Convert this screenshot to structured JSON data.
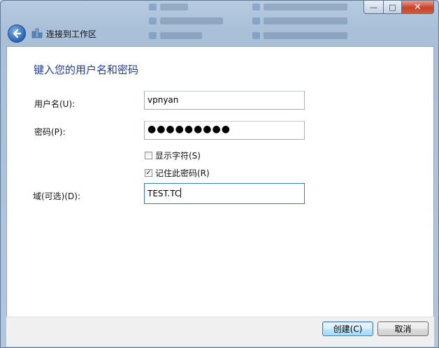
{
  "window": {
    "title": "连接到工作区",
    "caption": {
      "minimize": "—",
      "maximize": "□",
      "close": "✕"
    }
  },
  "form": {
    "heading": "键入您的用户名和密码",
    "username": {
      "label": "用户名(U):",
      "value": "vpnyan"
    },
    "password": {
      "label": "密码(P):",
      "value": "●●●●●●●●●"
    },
    "show_chars": {
      "label": "显示字符(S)",
      "checked": false
    },
    "remember": {
      "label": "记住此密码(R)",
      "checked": true,
      "mark": "✓"
    },
    "domain": {
      "label": "域(可选)(D):",
      "value": "TEST.TC"
    }
  },
  "footer": {
    "create_label": "创建(C)",
    "cancel_label": "取消"
  },
  "icons": {
    "back": "back-arrow-icon",
    "network": "network-connection-icon"
  },
  "colors": {
    "heading": "#1e3c9a",
    "close_button": "#c7432b",
    "focus_border": "#3d7bad"
  }
}
